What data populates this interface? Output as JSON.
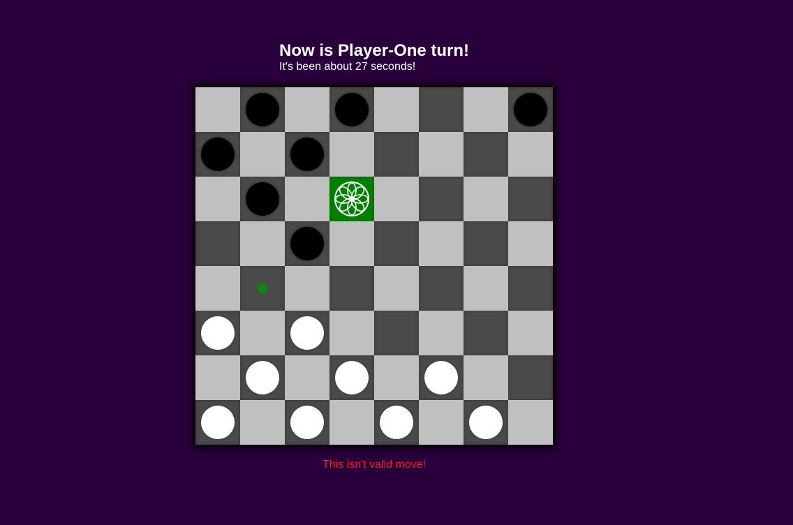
{
  "header": {
    "turn_text": "Now is Player-One turn!",
    "timer_text": "It's been about 27 seconds!"
  },
  "status": {
    "message": "This isn't valid move!",
    "message_color": "#ff1a1a"
  },
  "colors": {
    "background": "#2a003c",
    "light_square": "#c0c0c0",
    "dark_square": "#4a4a4a",
    "selected_square": "#008000",
    "hint": "#0a8a0a"
  },
  "board": {
    "rows": 8,
    "cols": 8,
    "pieces": [
      {
        "row": 0,
        "col": 1,
        "color": "black"
      },
      {
        "row": 0,
        "col": 3,
        "color": "black"
      },
      {
        "row": 0,
        "col": 7,
        "color": "black"
      },
      {
        "row": 1,
        "col": 0,
        "color": "black"
      },
      {
        "row": 1,
        "col": 2,
        "color": "black"
      },
      {
        "row": 2,
        "col": 1,
        "color": "black"
      },
      {
        "row": 2,
        "col": 3,
        "color": "white",
        "king": true,
        "selected": true
      },
      {
        "row": 3,
        "col": 2,
        "color": "black"
      },
      {
        "row": 5,
        "col": 0,
        "color": "white"
      },
      {
        "row": 5,
        "col": 2,
        "color": "white"
      },
      {
        "row": 6,
        "col": 1,
        "color": "white"
      },
      {
        "row": 6,
        "col": 3,
        "color": "white"
      },
      {
        "row": 6,
        "col": 5,
        "color": "white"
      },
      {
        "row": 7,
        "col": 0,
        "color": "white"
      },
      {
        "row": 7,
        "col": 2,
        "color": "white"
      },
      {
        "row": 7,
        "col": 4,
        "color": "white"
      },
      {
        "row": 7,
        "col": 6,
        "color": "white"
      }
    ],
    "hints": [
      {
        "row": 4,
        "col": 1
      }
    ]
  }
}
